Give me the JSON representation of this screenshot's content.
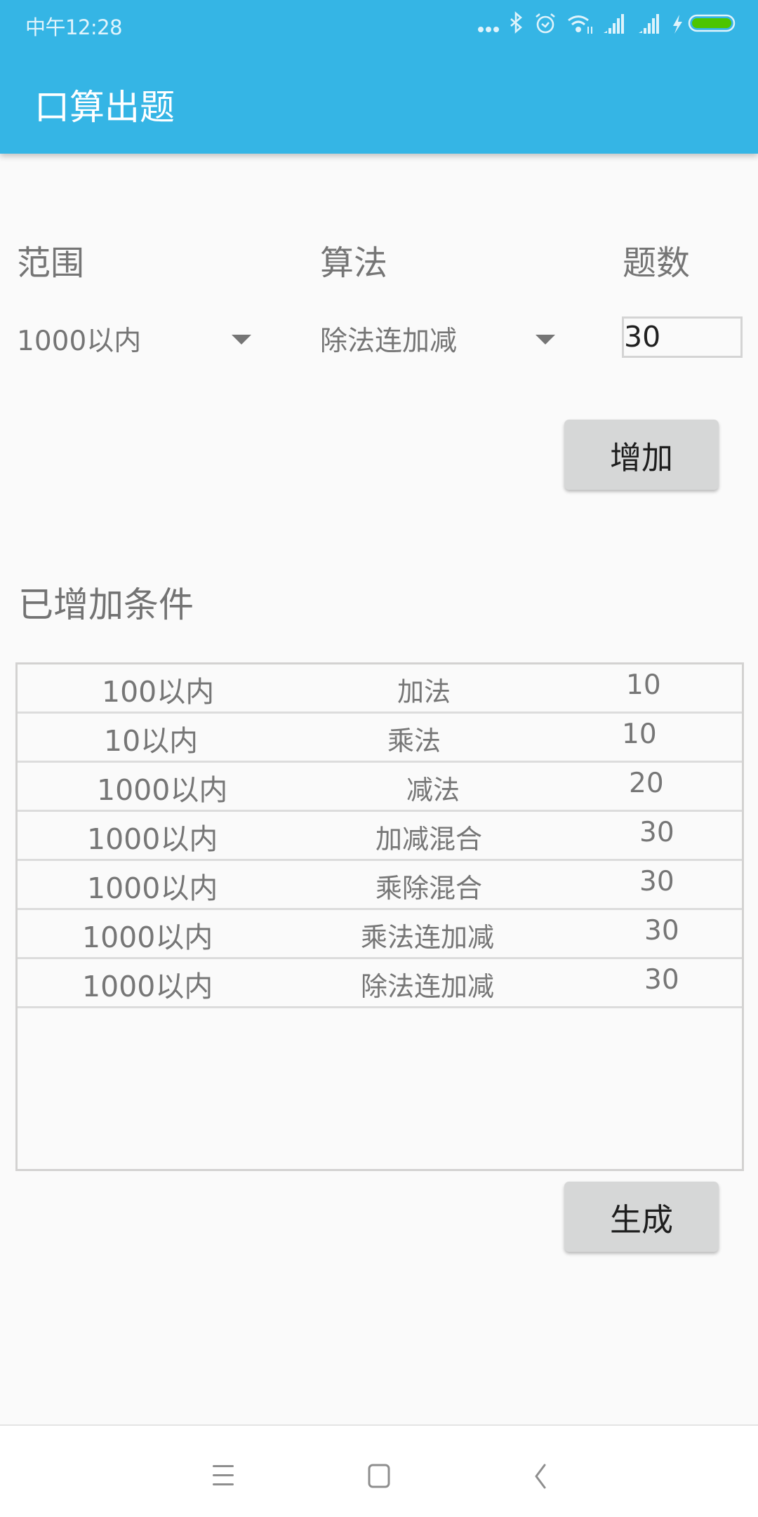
{
  "status_bar": {
    "time": "中午12:28",
    "icons": [
      "more-dots-icon",
      "bluetooth-icon",
      "alarm-icon",
      "wifi-icon",
      "signal-icon",
      "signal-icon",
      "charging-icon",
      "battery-icon"
    ],
    "battery_color": "#4cc500"
  },
  "app_bar": {
    "title": "口算出题",
    "color": "#35b5e5"
  },
  "form": {
    "range_label": "范围",
    "algorithm_label": "算法",
    "count_label": "题数",
    "range_selected": "1000以内",
    "algorithm_selected": "除法连加减",
    "count_value": "30",
    "add_button": "增加"
  },
  "conditions": {
    "heading": "已增加条件",
    "rows": [
      {
        "range": "100以内",
        "algorithm": "加法",
        "count": "10"
      },
      {
        "range": "10以内",
        "algorithm": "乘法",
        "count": "10"
      },
      {
        "range": "1000以内",
        "algorithm": "减法",
        "count": "20"
      },
      {
        "range": "1000以内",
        "algorithm": "加减混合",
        "count": "30"
      },
      {
        "range": "1000以内",
        "algorithm": "乘除混合",
        "count": "30"
      },
      {
        "range": "1000以内",
        "algorithm": "乘法连加减",
        "count": "30"
      },
      {
        "range": "1000以内",
        "algorithm": "除法连加减",
        "count": "30"
      }
    ]
  },
  "generate_button": "生成",
  "nav_bar": {
    "icons": [
      "menu-icon",
      "home-icon",
      "back-icon"
    ]
  }
}
